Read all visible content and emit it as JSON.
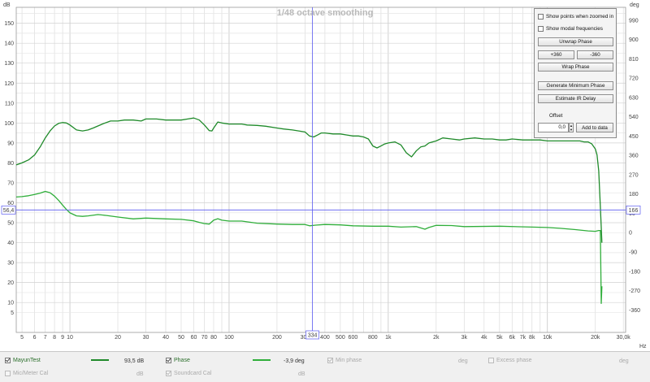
{
  "chart_data": {
    "type": "line",
    "title": "1/48 octave smoothing",
    "xscale": "log",
    "xlim": [
      4.6,
      31000
    ],
    "x_unit": "Hz",
    "x_ticks": [
      {
        "v": 5,
        "l": "5"
      },
      {
        "v": 6,
        "l": "6"
      },
      {
        "v": 7,
        "l": "7"
      },
      {
        "v": 8,
        "l": "8"
      },
      {
        "v": 9,
        "l": "9"
      },
      {
        "v": 10,
        "l": "10"
      },
      {
        "v": 20,
        "l": "20"
      },
      {
        "v": 30,
        "l": "30"
      },
      {
        "v": 40,
        "l": "40"
      },
      {
        "v": 50,
        "l": "50"
      },
      {
        "v": 60,
        "l": "60"
      },
      {
        "v": 70,
        "l": "70"
      },
      {
        "v": 80,
        "l": "80"
      },
      {
        "v": 100,
        "l": "100"
      },
      {
        "v": 200,
        "l": "200"
      },
      {
        "v": 300,
        "l": "300"
      },
      {
        "v": 400,
        "l": "400"
      },
      {
        "v": 500,
        "l": "500"
      },
      {
        "v": 600,
        "l": "600"
      },
      {
        "v": 800,
        "l": "800"
      },
      {
        "v": 1000,
        "l": "1k"
      },
      {
        "v": 2000,
        "l": "2k"
      },
      {
        "v": 3000,
        "l": "3k"
      },
      {
        "v": 4000,
        "l": "4k"
      },
      {
        "v": 5000,
        "l": "5k"
      },
      {
        "v": 6000,
        "l": "6k"
      },
      {
        "v": 7000,
        "l": "7k"
      },
      {
        "v": 8000,
        "l": "8k"
      },
      {
        "v": 10000,
        "l": "10k"
      },
      {
        "v": 20000,
        "l": "20k"
      },
      {
        "v": 30000,
        "l": "30,0k"
      }
    ],
    "y_left": {
      "label": "dB",
      "lim": [
        -5,
        158
      ],
      "ticks": [
        5,
        10,
        20,
        30,
        40,
        50,
        60,
        70,
        80,
        90,
        100,
        110,
        120,
        130,
        140,
        150
      ]
    },
    "y_right": {
      "label": "deg",
      "lim": [
        -465,
        1050
      ],
      "ticks": [
        -360,
        -270,
        -180,
        -90,
        0,
        90,
        180,
        270,
        360,
        450,
        540,
        630,
        720,
        810,
        900,
        990
      ]
    },
    "grid": true,
    "cursor": {
      "x": 334,
      "x_label": "334",
      "y": 56.4,
      "y_label": "56,4",
      "y_right_label": "166"
    },
    "series": [
      {
        "name": "MayunTest",
        "axis": "left",
        "color": "#1f8a2a",
        "x": [
          4.6,
          5,
          5.5,
          6,
          6.5,
          7,
          7.5,
          8,
          8.5,
          9,
          9.5,
          10,
          11,
          12,
          13,
          14,
          16,
          18,
          20,
          22,
          25,
          28,
          30,
          35,
          40,
          45,
          50,
          55,
          60,
          65,
          70,
          75,
          78,
          80,
          85,
          90,
          100,
          110,
          120,
          130,
          150,
          170,
          200,
          220,
          250,
          300,
          320,
          340,
          360,
          380,
          400,
          450,
          500,
          550,
          600,
          650,
          700,
          750,
          800,
          850,
          900,
          950,
          1000,
          1100,
          1200,
          1300,
          1400,
          1500,
          1600,
          1700,
          1800,
          2000,
          2200,
          2500,
          2800,
          3000,
          3500,
          4000,
          4500,
          5000,
          5500,
          6000,
          7000,
          8000,
          9000,
          10000,
          12000,
          14000,
          16000,
          17000,
          18000,
          19000,
          20000,
          20500,
          21000,
          21500,
          22000
        ],
        "y": [
          79,
          80,
          81.5,
          84,
          88,
          92.5,
          96,
          98.5,
          99.8,
          100.2,
          100,
          99,
          96.5,
          96,
          96.5,
          97.5,
          99.5,
          101,
          101,
          101.5,
          101.5,
          101,
          102,
          102,
          101.5,
          101.5,
          101.5,
          102,
          102.5,
          101.5,
          99,
          96.2,
          96,
          97.5,
          100.5,
          100,
          99.5,
          99.5,
          99.5,
          99,
          98.8,
          98.4,
          97.5,
          97,
          96.5,
          95.5,
          93.5,
          93,
          94,
          95,
          95,
          94.5,
          94.5,
          94,
          93.5,
          93.5,
          93,
          92,
          88.5,
          87.5,
          88.5,
          89.5,
          90,
          90.5,
          89,
          85,
          83,
          86,
          88,
          88.5,
          90,
          91,
          92.5,
          92,
          91.5,
          92,
          92.5,
          92,
          92,
          91.5,
          91.5,
          92,
          91.5,
          91.5,
          91.5,
          91,
          91,
          91,
          91,
          90.5,
          90.5,
          89.5,
          87,
          84,
          76,
          58,
          40
        ]
      },
      {
        "name": "Phase",
        "axis": "right",
        "color": "#2fae3a",
        "x": [
          4.6,
          5,
          5.5,
          6,
          6.5,
          7,
          7.5,
          8,
          8.5,
          9,
          9.5,
          10,
          11,
          12,
          13,
          15,
          17,
          20,
          25,
          30,
          40,
          50,
          60,
          65,
          70,
          75,
          80,
          85,
          90,
          100,
          120,
          150,
          200,
          250,
          300,
          320,
          350,
          400,
          500,
          600,
          800,
          1000,
          1200,
          1500,
          1700,
          1800,
          2000,
          2500,
          3000,
          5000,
          8000,
          10000,
          12000,
          15000,
          18000,
          20000,
          21000,
          21500,
          21800,
          22000
        ],
        "y": [
          166,
          168,
          172,
          178,
          184,
          192,
          186,
          170,
          150,
          128,
          108,
          92,
          78,
          76,
          78,
          84,
          80,
          73,
          64,
          68,
          64,
          62,
          55,
          48,
          42,
          40,
          58,
          65,
          58,
          54,
          54,
          44,
          40,
          38,
          38,
          32,
          35,
          38,
          36,
          32,
          30,
          30,
          26,
          28,
          16,
          24,
          34,
          33,
          28,
          30,
          26,
          24,
          20,
          14,
          8,
          6,
          10,
          10,
          -330,
          -250
        ]
      }
    ]
  },
  "panel": {
    "show_points": "Show points when zoomed in",
    "show_modal": "Show modal frequencies",
    "unwrap": "Unwrap Phase",
    "plus360": "+360",
    "minus360": "-360",
    "wrap": "Wrap Phase",
    "gen_min_phase": "Generate Minimum Phase",
    "estimate_ir": "Estimate IR Delay",
    "offset_label": "Offset",
    "offset_value": "0,0",
    "add_to_data": "Add to data"
  },
  "legend": {
    "mayun_name": "MayunTest",
    "mayun_value": "93,5 dB",
    "phase_name": "Phase",
    "phase_value": "-3,9 deg",
    "min_phase_name": "Min phase",
    "min_phase_unit": "deg",
    "excess_name": "Excess phase",
    "excess_unit": "deg",
    "mic_cal_name": "Mic/Meter Cal",
    "mic_cal_unit": "dB",
    "sc_cal_name": "Soundcard Cal",
    "sc_cal_unit": "dB"
  }
}
